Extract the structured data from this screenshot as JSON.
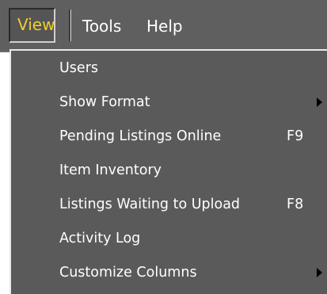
{
  "menubar": {
    "items": [
      {
        "label": "View",
        "active": true
      },
      {
        "label": "Tools",
        "active": false
      },
      {
        "label": "Help",
        "active": false
      }
    ]
  },
  "view_menu": {
    "items": [
      {
        "label": "Users",
        "shortcut": "",
        "has_submenu": false
      },
      {
        "label": "Show Format",
        "shortcut": "",
        "has_submenu": true
      },
      {
        "label": "Pending Listings Online",
        "shortcut": "F9",
        "has_submenu": false
      },
      {
        "label": "Item Inventory",
        "shortcut": "",
        "has_submenu": false
      },
      {
        "label": "Listings Waiting to Upload",
        "shortcut": "F8",
        "has_submenu": false
      },
      {
        "label": "Activity Log",
        "shortcut": "",
        "has_submenu": false
      },
      {
        "label": "Customize Columns",
        "shortcut": "",
        "has_submenu": true
      }
    ]
  },
  "colors": {
    "menubar_bg": "#5f5f5f",
    "menu_bg": "#5a5a5a",
    "active_text": "#f2ce2a",
    "text": "#ffffff"
  },
  "icons": {
    "submenu": "triangle-right-icon"
  }
}
